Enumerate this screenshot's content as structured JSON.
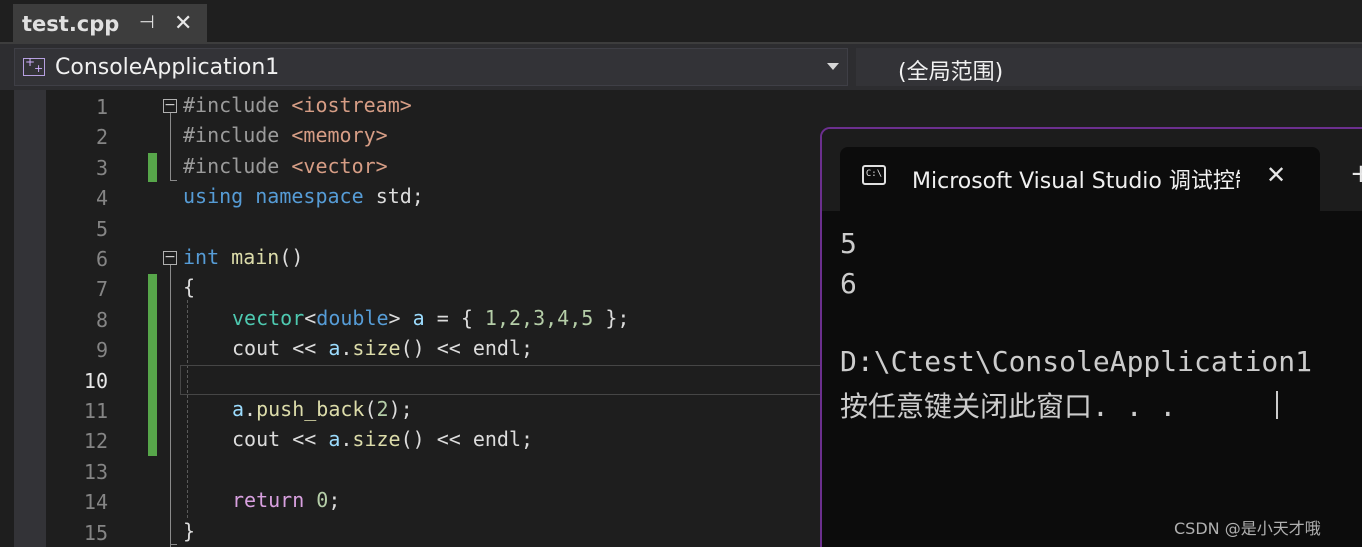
{
  "tab": {
    "filename": "test.cpp",
    "pin_glyph": "⊣",
    "close_glyph": "✕"
  },
  "navbar": {
    "project": "ConsoleApplication1",
    "scope": "(全局范围)"
  },
  "editor": {
    "current_line": 10,
    "line_numbers": [
      "1",
      "2",
      "3",
      "4",
      "5",
      "6",
      "7",
      "8",
      "9",
      "10",
      "11",
      "12",
      "13",
      "14",
      "15"
    ],
    "code": {
      "l1_kw": "#include",
      "l1_hdr": "<iostream>",
      "l2_kw": "#include",
      "l2_hdr": "<memory>",
      "l3_kw": "#include",
      "l3_hdr": "<vector>",
      "l4_using": "using",
      "l4_ns": "namespace",
      "l4_std": "std;",
      "l6_int": "int",
      "l6_main": "main",
      "l6_paren": "()",
      "l7_brace": "{",
      "l8_vector": "vector",
      "l8_lt": "<",
      "l8_double": "double",
      "l8_gt": ">",
      "l8_a": "a",
      "l8_eq": " = ",
      "l8_open": "{ ",
      "l8_nums": "1,2,3,4,5",
      "l8_close": " };",
      "l9_cout": "cout << ",
      "l9_a": "a",
      "l9_dot": ".",
      "l9_size": "size",
      "l9_rest": "() << endl;",
      "l11_a": "a",
      "l11_dot": ".",
      "l11_fn": "push_back",
      "l11_open": "(",
      "l11_num": "2",
      "l11_close": ");",
      "l12_cout": "cout << ",
      "l12_a": "a",
      "l12_dot": ".",
      "l12_size": "size",
      "l12_rest": "() << endl;",
      "l14_ret": "return",
      "l14_num": "0",
      "l14_semi": ";",
      "l15_brace": "}"
    }
  },
  "console": {
    "title": "Microsoft Visual Studio 调试控制台",
    "icon_text": "C:\\",
    "close_glyph": "✕",
    "newtab_glyph": "+",
    "output": [
      "5",
      "6",
      "",
      "D:\\Ctest\\ConsoleApplication1",
      "按任意键关闭此窗口. . ."
    ]
  },
  "watermark": "CSDN @是小天才哦",
  "colors": {
    "keyword": "#569cd6",
    "type": "#4ec9b0",
    "string": "#d69d85",
    "number": "#b5cea8",
    "control": "#d8a0df",
    "change_marker": "#57a64a",
    "console_border": "#6b2f8e"
  }
}
